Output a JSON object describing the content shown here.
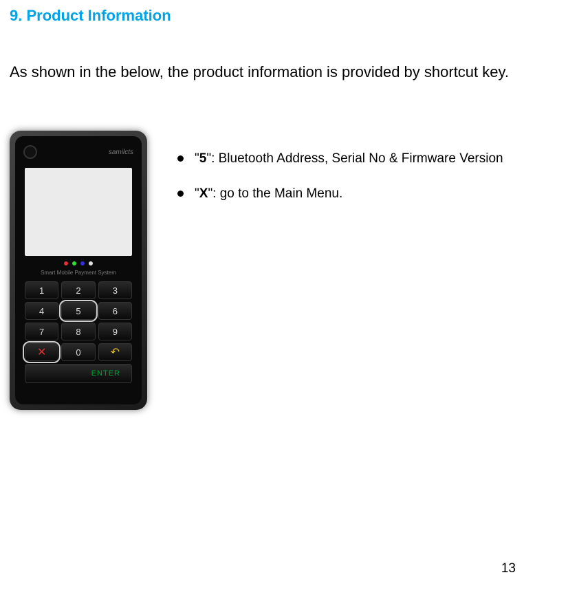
{
  "heading": "9. Product Information",
  "intro": "As shown in the below, the product information is provided by shortcut key.",
  "device": {
    "brand": "samilcts",
    "subLabel": "Smart Mobile Payment System",
    "keypad": [
      "1",
      "2",
      "3",
      "4",
      "5",
      "6",
      "7",
      "8",
      "9",
      "✕",
      "0",
      "↶"
    ],
    "enterLabel": "ENTER"
  },
  "bullets": [
    {
      "keyBold": "5",
      "prefix": "\"",
      "suffix": "\": Bluetooth Address, Serial No & Firmware Version"
    },
    {
      "keyBold": "X",
      "prefix": "\"",
      "suffix": "\": go to the Main Menu."
    }
  ],
  "pageNumber": "13"
}
